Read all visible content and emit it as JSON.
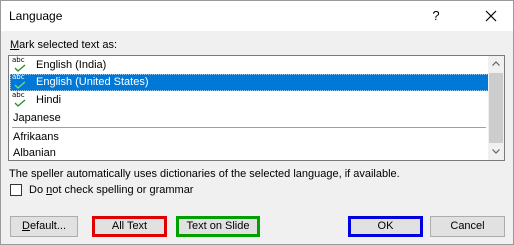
{
  "dialog": {
    "title": "Language",
    "help_glyph": "?",
    "close_icon": "close-icon"
  },
  "list": {
    "label_accel": "M",
    "label_rest": "ark selected text as:",
    "items": [
      {
        "label": "English (India)",
        "proofing_icon": true,
        "selected": false
      },
      {
        "label": "English (United States)",
        "proofing_icon": true,
        "selected": true
      },
      {
        "label": "Hindi",
        "proofing_icon": true,
        "selected": false
      },
      {
        "label": "Japanese",
        "proofing_icon": false,
        "selected": false
      },
      {
        "label": "Afrikaans",
        "proofing_icon": false,
        "selected": false
      },
      {
        "label": "Albanian",
        "proofing_icon": false,
        "selected": false
      }
    ],
    "proofing_icon_text": "abc"
  },
  "info_text": "The speller automatically uses dictionaries of the selected language, if available.",
  "checkbox": {
    "label_pre": "Do ",
    "label_accel": "n",
    "label_post": "ot check spelling or grammar",
    "checked": false
  },
  "buttons": {
    "default_accel": "D",
    "default_rest": "efault...",
    "all_text": "All Text",
    "text_on_slide": "Text on Slide",
    "ok": "OK",
    "cancel": "Cancel"
  },
  "highlight_colors": {
    "all_text": "#e00000",
    "text_on_slide": "#00a000",
    "ok": "#0000e0"
  },
  "selection_color": "#0078d7"
}
